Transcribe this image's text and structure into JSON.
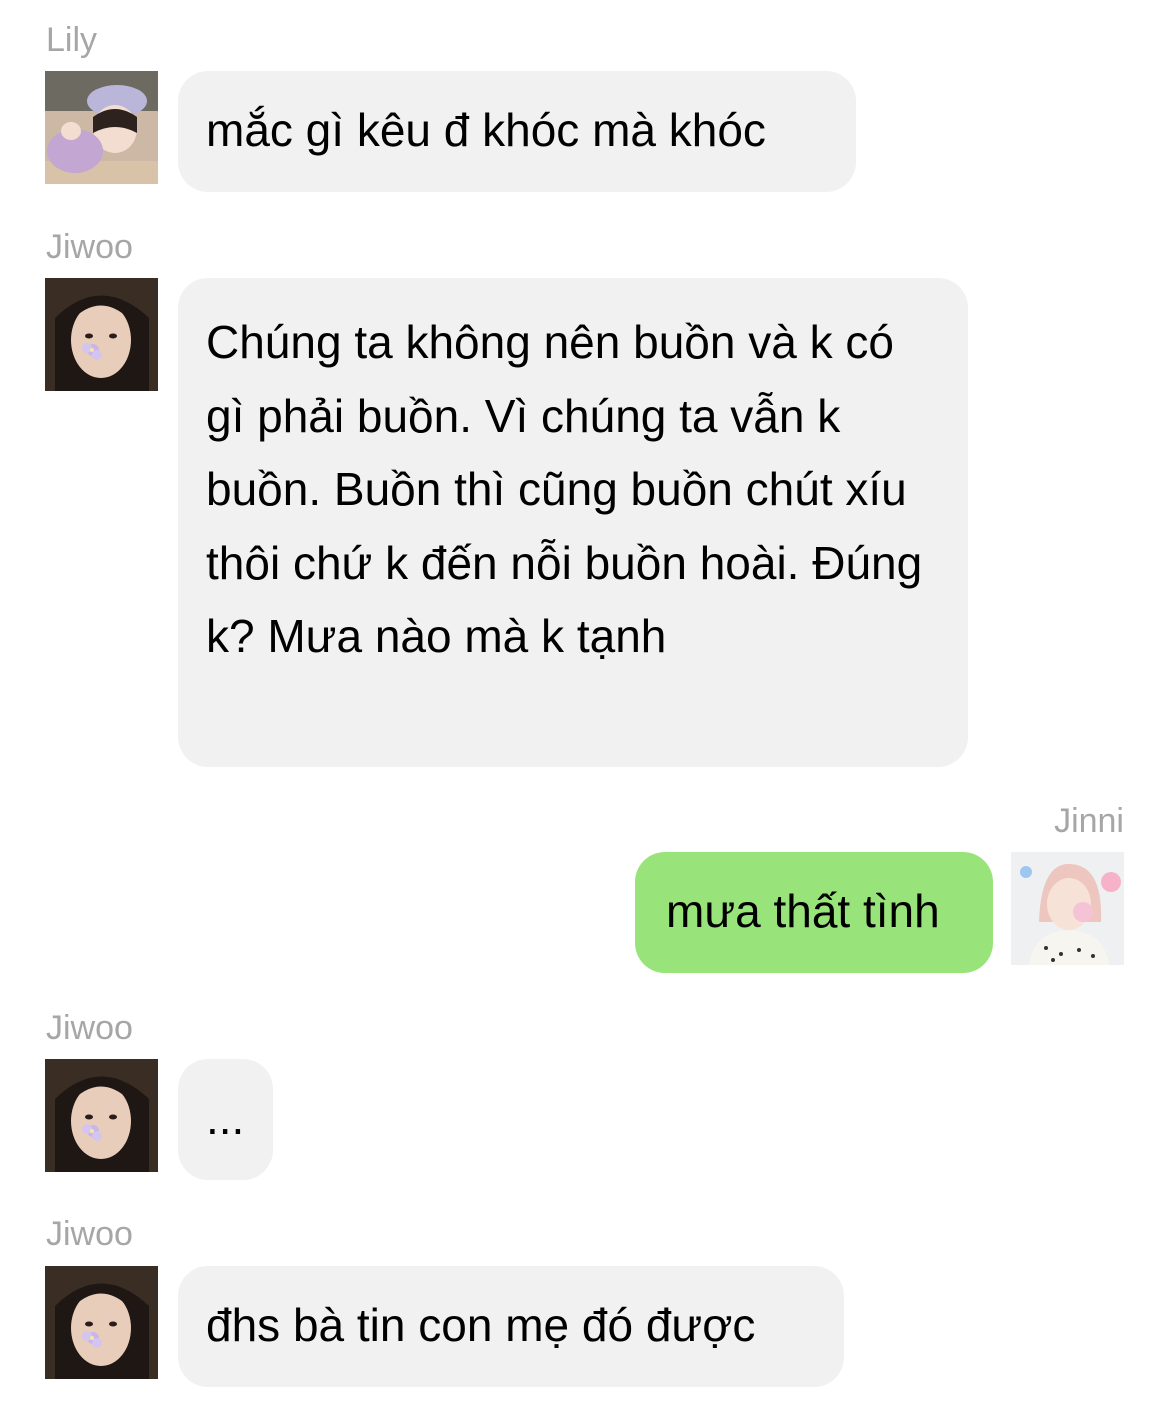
{
  "messages": [
    {
      "sender": "Lily",
      "avatar": "lily-avatar",
      "text": "mắc gì kêu đ khóc mà khóc",
      "direction": "incoming"
    },
    {
      "sender": "Jiwoo",
      "avatar": "jiwoo-avatar",
      "text": "Chúng ta không nên buồn và k có gì phải buồn. Vì chúng ta vẫn k buồn. Buồn thì cũng buồn chút xíu thôi chứ k đến nỗi buồn hoài. Đúng k? Mưa nào mà k tạnh",
      "direction": "incoming"
    },
    {
      "sender": "Jinni",
      "avatar": "jinni-avatar",
      "text": "mưa thất tình",
      "direction": "outgoing"
    },
    {
      "sender": "Jiwoo",
      "avatar": "jiwoo-avatar",
      "text": "...",
      "direction": "incoming"
    },
    {
      "sender": "Jiwoo",
      "avatar": "jiwoo-avatar",
      "text": "đhs bà tin con mẹ đó được",
      "direction": "incoming"
    }
  ],
  "colors": {
    "incoming_bubble": "#f1f1f1",
    "outgoing_bubble": "#99e47a",
    "sender_name": "#a6a6a6",
    "text": "#000000"
  }
}
